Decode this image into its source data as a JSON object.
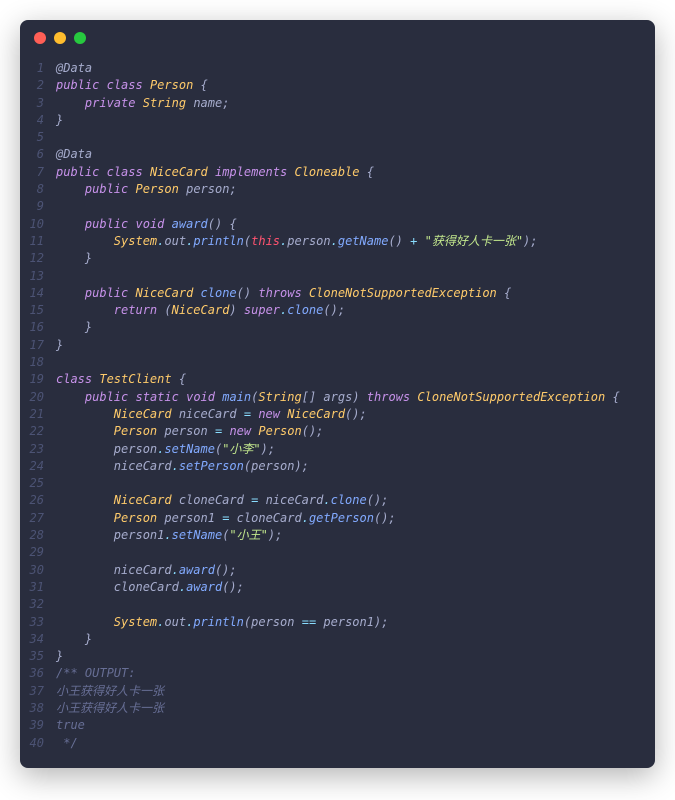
{
  "window": {
    "dots": [
      "red",
      "yellow",
      "green"
    ]
  },
  "lines": [
    {
      "n": 1,
      "tokens": [
        [
          "tk-ann",
          "@Data"
        ]
      ]
    },
    {
      "n": 2,
      "tokens": [
        [
          "tk-kw",
          "public"
        ],
        [
          "tk-id",
          " "
        ],
        [
          "tk-kw",
          "class"
        ],
        [
          "tk-id",
          " "
        ],
        [
          "tk-type",
          "Person"
        ],
        [
          "tk-id",
          " "
        ],
        [
          "tk-pun",
          "{"
        ]
      ]
    },
    {
      "n": 3,
      "tokens": [
        [
          "tk-id",
          "    "
        ],
        [
          "tk-kw",
          "private"
        ],
        [
          "tk-id",
          " "
        ],
        [
          "tk-type",
          "String"
        ],
        [
          "tk-id",
          " "
        ],
        [
          "tk-id",
          "name"
        ],
        [
          "tk-pun",
          ";"
        ]
      ]
    },
    {
      "n": 4,
      "tokens": [
        [
          "tk-pun",
          "}"
        ]
      ]
    },
    {
      "n": 5,
      "tokens": [
        [
          "tk-id",
          ""
        ]
      ]
    },
    {
      "n": 6,
      "tokens": [
        [
          "tk-ann",
          "@Data"
        ]
      ]
    },
    {
      "n": 7,
      "tokens": [
        [
          "tk-kw",
          "public"
        ],
        [
          "tk-id",
          " "
        ],
        [
          "tk-kw",
          "class"
        ],
        [
          "tk-id",
          " "
        ],
        [
          "tk-type",
          "NiceCard"
        ],
        [
          "tk-id",
          " "
        ],
        [
          "tk-kw",
          "implements"
        ],
        [
          "tk-id",
          " "
        ],
        [
          "tk-type",
          "Cloneable"
        ],
        [
          "tk-id",
          " "
        ],
        [
          "tk-pun",
          "{"
        ]
      ]
    },
    {
      "n": 8,
      "tokens": [
        [
          "tk-id",
          "    "
        ],
        [
          "tk-kw",
          "public"
        ],
        [
          "tk-id",
          " "
        ],
        [
          "tk-type",
          "Person"
        ],
        [
          "tk-id",
          " "
        ],
        [
          "tk-id",
          "person"
        ],
        [
          "tk-pun",
          ";"
        ]
      ]
    },
    {
      "n": 9,
      "tokens": [
        [
          "tk-id",
          ""
        ]
      ]
    },
    {
      "n": 10,
      "tokens": [
        [
          "tk-id",
          "    "
        ],
        [
          "tk-kw",
          "public"
        ],
        [
          "tk-id",
          " "
        ],
        [
          "tk-kw",
          "void"
        ],
        [
          "tk-id",
          " "
        ],
        [
          "tk-func",
          "award"
        ],
        [
          "tk-pun",
          "()"
        ],
        [
          "tk-id",
          " "
        ],
        [
          "tk-pun",
          "{"
        ]
      ]
    },
    {
      "n": 11,
      "tokens": [
        [
          "tk-id",
          "        "
        ],
        [
          "tk-type",
          "System"
        ],
        [
          "tk-op",
          "."
        ],
        [
          "tk-id",
          "out"
        ],
        [
          "tk-op",
          "."
        ],
        [
          "tk-func",
          "println"
        ],
        [
          "tk-pun",
          "("
        ],
        [
          "tk-this",
          "this"
        ],
        [
          "tk-op",
          "."
        ],
        [
          "tk-id",
          "person"
        ],
        [
          "tk-op",
          "."
        ],
        [
          "tk-func",
          "getName"
        ],
        [
          "tk-pun",
          "()"
        ],
        [
          "tk-id",
          " "
        ],
        [
          "tk-op",
          "+"
        ],
        [
          "tk-id",
          " "
        ],
        [
          "tk-str",
          "\"获得好人卡一张\""
        ],
        [
          "tk-pun",
          ");"
        ]
      ]
    },
    {
      "n": 12,
      "tokens": [
        [
          "tk-id",
          "    "
        ],
        [
          "tk-pun",
          "}"
        ]
      ]
    },
    {
      "n": 13,
      "tokens": [
        [
          "tk-id",
          ""
        ]
      ]
    },
    {
      "n": 14,
      "tokens": [
        [
          "tk-id",
          "    "
        ],
        [
          "tk-kw",
          "public"
        ],
        [
          "tk-id",
          " "
        ],
        [
          "tk-type",
          "NiceCard"
        ],
        [
          "tk-id",
          " "
        ],
        [
          "tk-func",
          "clone"
        ],
        [
          "tk-pun",
          "()"
        ],
        [
          "tk-id",
          " "
        ],
        [
          "tk-kw",
          "throws"
        ],
        [
          "tk-id",
          " "
        ],
        [
          "tk-type",
          "CloneNotSupportedException"
        ],
        [
          "tk-id",
          " "
        ],
        [
          "tk-pun",
          "{"
        ]
      ]
    },
    {
      "n": 15,
      "tokens": [
        [
          "tk-id",
          "        "
        ],
        [
          "tk-kw",
          "return"
        ],
        [
          "tk-id",
          " "
        ],
        [
          "tk-pun",
          "("
        ],
        [
          "tk-type",
          "NiceCard"
        ],
        [
          "tk-pun",
          ")"
        ],
        [
          "tk-id",
          " "
        ],
        [
          "tk-kw",
          "super"
        ],
        [
          "tk-op",
          "."
        ],
        [
          "tk-func",
          "clone"
        ],
        [
          "tk-pun",
          "();"
        ]
      ]
    },
    {
      "n": 16,
      "tokens": [
        [
          "tk-id",
          "    "
        ],
        [
          "tk-pun",
          "}"
        ]
      ]
    },
    {
      "n": 17,
      "tokens": [
        [
          "tk-pun",
          "}"
        ]
      ]
    },
    {
      "n": 18,
      "tokens": [
        [
          "tk-id",
          ""
        ]
      ]
    },
    {
      "n": 19,
      "tokens": [
        [
          "tk-kw",
          "class"
        ],
        [
          "tk-id",
          " "
        ],
        [
          "tk-type",
          "TestClient"
        ],
        [
          "tk-id",
          " "
        ],
        [
          "tk-pun",
          "{"
        ]
      ]
    },
    {
      "n": 20,
      "tokens": [
        [
          "tk-id",
          "    "
        ],
        [
          "tk-kw",
          "public"
        ],
        [
          "tk-id",
          " "
        ],
        [
          "tk-kw",
          "static"
        ],
        [
          "tk-id",
          " "
        ],
        [
          "tk-kw",
          "void"
        ],
        [
          "tk-id",
          " "
        ],
        [
          "tk-func",
          "main"
        ],
        [
          "tk-pun",
          "("
        ],
        [
          "tk-type",
          "String"
        ],
        [
          "tk-pun",
          "[]"
        ],
        [
          "tk-id",
          " "
        ],
        [
          "tk-id",
          "args"
        ],
        [
          "tk-pun",
          ")"
        ],
        [
          "tk-id",
          " "
        ],
        [
          "tk-kw",
          "throws"
        ],
        [
          "tk-id",
          " "
        ],
        [
          "tk-type",
          "CloneNotSupportedException"
        ],
        [
          "tk-id",
          " "
        ],
        [
          "tk-pun",
          "{"
        ]
      ]
    },
    {
      "n": 21,
      "tokens": [
        [
          "tk-id",
          "        "
        ],
        [
          "tk-type",
          "NiceCard"
        ],
        [
          "tk-id",
          " "
        ],
        [
          "tk-id",
          "niceCard"
        ],
        [
          "tk-id",
          " "
        ],
        [
          "tk-op",
          "="
        ],
        [
          "tk-id",
          " "
        ],
        [
          "tk-kw",
          "new"
        ],
        [
          "tk-id",
          " "
        ],
        [
          "tk-type",
          "NiceCard"
        ],
        [
          "tk-pun",
          "();"
        ]
      ]
    },
    {
      "n": 22,
      "tokens": [
        [
          "tk-id",
          "        "
        ],
        [
          "tk-type",
          "Person"
        ],
        [
          "tk-id",
          " "
        ],
        [
          "tk-id",
          "person"
        ],
        [
          "tk-id",
          " "
        ],
        [
          "tk-op",
          "="
        ],
        [
          "tk-id",
          " "
        ],
        [
          "tk-kw",
          "new"
        ],
        [
          "tk-id",
          " "
        ],
        [
          "tk-type",
          "Person"
        ],
        [
          "tk-pun",
          "();"
        ]
      ]
    },
    {
      "n": 23,
      "tokens": [
        [
          "tk-id",
          "        "
        ],
        [
          "tk-id",
          "person"
        ],
        [
          "tk-op",
          "."
        ],
        [
          "tk-func",
          "setName"
        ],
        [
          "tk-pun",
          "("
        ],
        [
          "tk-str",
          "\"小李\""
        ],
        [
          "tk-pun",
          ");"
        ]
      ]
    },
    {
      "n": 24,
      "tokens": [
        [
          "tk-id",
          "        "
        ],
        [
          "tk-id",
          "niceCard"
        ],
        [
          "tk-op",
          "."
        ],
        [
          "tk-func",
          "setPerson"
        ],
        [
          "tk-pun",
          "("
        ],
        [
          "tk-id",
          "person"
        ],
        [
          "tk-pun",
          ");"
        ]
      ]
    },
    {
      "n": 25,
      "tokens": [
        [
          "tk-id",
          ""
        ]
      ]
    },
    {
      "n": 26,
      "tokens": [
        [
          "tk-id",
          "        "
        ],
        [
          "tk-type",
          "NiceCard"
        ],
        [
          "tk-id",
          " "
        ],
        [
          "tk-id",
          "cloneCard"
        ],
        [
          "tk-id",
          " "
        ],
        [
          "tk-op",
          "="
        ],
        [
          "tk-id",
          " "
        ],
        [
          "tk-id",
          "niceCard"
        ],
        [
          "tk-op",
          "."
        ],
        [
          "tk-func",
          "clone"
        ],
        [
          "tk-pun",
          "();"
        ]
      ]
    },
    {
      "n": 27,
      "tokens": [
        [
          "tk-id",
          "        "
        ],
        [
          "tk-type",
          "Person"
        ],
        [
          "tk-id",
          " "
        ],
        [
          "tk-id",
          "person1"
        ],
        [
          "tk-id",
          " "
        ],
        [
          "tk-op",
          "="
        ],
        [
          "tk-id",
          " "
        ],
        [
          "tk-id",
          "cloneCard"
        ],
        [
          "tk-op",
          "."
        ],
        [
          "tk-func",
          "getPerson"
        ],
        [
          "tk-pun",
          "();"
        ]
      ]
    },
    {
      "n": 28,
      "tokens": [
        [
          "tk-id",
          "        "
        ],
        [
          "tk-id",
          "person1"
        ],
        [
          "tk-op",
          "."
        ],
        [
          "tk-func",
          "setName"
        ],
        [
          "tk-pun",
          "("
        ],
        [
          "tk-str",
          "\"小王\""
        ],
        [
          "tk-pun",
          ");"
        ]
      ]
    },
    {
      "n": 29,
      "tokens": [
        [
          "tk-id",
          ""
        ]
      ]
    },
    {
      "n": 30,
      "tokens": [
        [
          "tk-id",
          "        "
        ],
        [
          "tk-id",
          "niceCard"
        ],
        [
          "tk-op",
          "."
        ],
        [
          "tk-func",
          "award"
        ],
        [
          "tk-pun",
          "();"
        ]
      ]
    },
    {
      "n": 31,
      "tokens": [
        [
          "tk-id",
          "        "
        ],
        [
          "tk-id",
          "cloneCard"
        ],
        [
          "tk-op",
          "."
        ],
        [
          "tk-func",
          "award"
        ],
        [
          "tk-pun",
          "();"
        ]
      ]
    },
    {
      "n": 32,
      "tokens": [
        [
          "tk-id",
          ""
        ]
      ]
    },
    {
      "n": 33,
      "tokens": [
        [
          "tk-id",
          "        "
        ],
        [
          "tk-type",
          "System"
        ],
        [
          "tk-op",
          "."
        ],
        [
          "tk-id",
          "out"
        ],
        [
          "tk-op",
          "."
        ],
        [
          "tk-func",
          "println"
        ],
        [
          "tk-pun",
          "("
        ],
        [
          "tk-id",
          "person"
        ],
        [
          "tk-id",
          " "
        ],
        [
          "tk-op",
          "=="
        ],
        [
          "tk-id",
          " "
        ],
        [
          "tk-id",
          "person1"
        ],
        [
          "tk-pun",
          ");"
        ]
      ]
    },
    {
      "n": 34,
      "tokens": [
        [
          "tk-id",
          "    "
        ],
        [
          "tk-pun",
          "}"
        ]
      ]
    },
    {
      "n": 35,
      "tokens": [
        [
          "tk-pun",
          "}"
        ]
      ]
    },
    {
      "n": 36,
      "tokens": [
        [
          "tk-cmt",
          "/** OUTPUT:"
        ]
      ]
    },
    {
      "n": 37,
      "tokens": [
        [
          "tk-cmt",
          "小王获得好人卡一张"
        ]
      ]
    },
    {
      "n": 38,
      "tokens": [
        [
          "tk-cmt",
          "小王获得好人卡一张"
        ]
      ]
    },
    {
      "n": 39,
      "tokens": [
        [
          "tk-cmt",
          "true"
        ]
      ]
    },
    {
      "n": 40,
      "tokens": [
        [
          "tk-cmt",
          " */"
        ]
      ]
    }
  ]
}
